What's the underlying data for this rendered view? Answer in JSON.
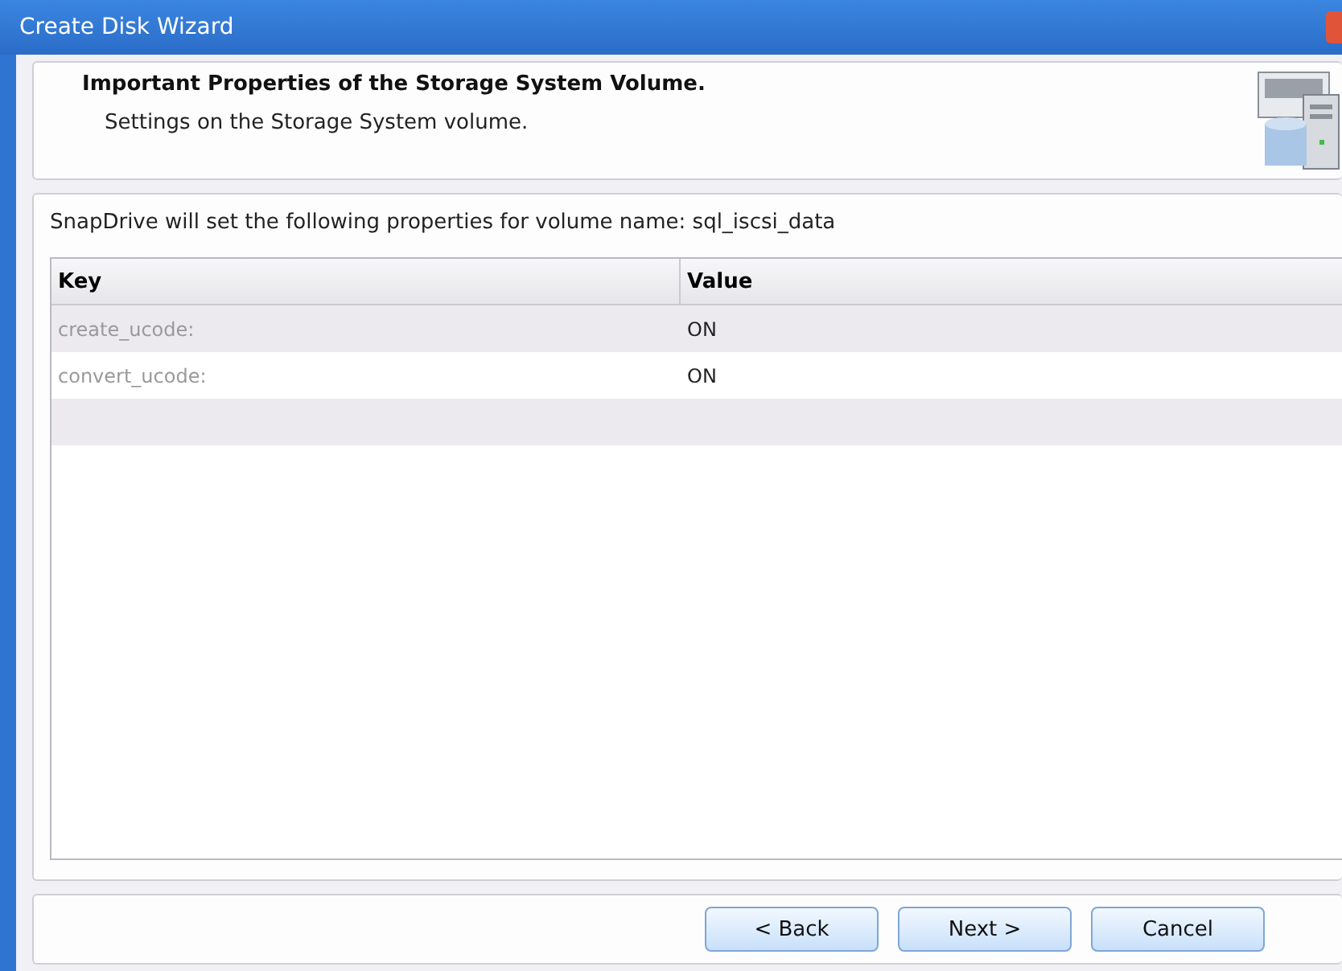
{
  "window": {
    "title": "Create Disk Wizard"
  },
  "header": {
    "title": "Important Properties of the Storage System Volume.",
    "subtitle": "Settings on the Storage System volume."
  },
  "description": "SnapDrive will set the following properties for volume name:  sql_iscsi_data",
  "table": {
    "columns": [
      "Key",
      "Value"
    ],
    "rows": [
      {
        "key": "create_ucode:",
        "value": "ON"
      },
      {
        "key": "convert_ucode:",
        "value": "ON"
      }
    ]
  },
  "buttons": [
    "< Back",
    "Next >",
    "Cancel"
  ]
}
